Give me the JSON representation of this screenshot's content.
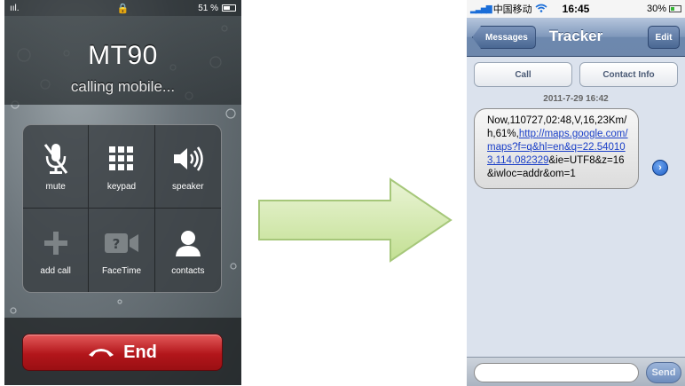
{
  "call_screen": {
    "status_bar": {
      "carrier_signal": "ııl.",
      "battery_text": "51 %"
    },
    "caller_name": "MT90",
    "call_status": "calling mobile...",
    "keys": [
      {
        "label": "mute",
        "icon": "muted-mic-icon"
      },
      {
        "label": "keypad",
        "icon": "keypad-grid-icon"
      },
      {
        "label": "speaker",
        "icon": "speaker-icon"
      },
      {
        "label": "add call",
        "icon": "plus-icon"
      },
      {
        "label": "FaceTime",
        "icon": "facetime-icon"
      },
      {
        "label": "contacts",
        "icon": "contacts-icon"
      }
    ],
    "end_label": "End"
  },
  "arrow": {
    "color": "#cfe6a8",
    "icon": "right-arrow-icon"
  },
  "sms_screen": {
    "status_bar": {
      "carrier": "中国移动",
      "time": "16:45",
      "battery": "30%"
    },
    "nav": {
      "back_label": "Messages",
      "title": "Tracker",
      "edit_label": "Edit"
    },
    "actions": {
      "call": "Call",
      "contact_info": "Contact Info"
    },
    "timestamp": "2011-7-29 16:42",
    "message": {
      "prefix": "Now,110727,02:48,V,16,23Km/h,61%,",
      "link": "http://maps.google.com/maps?f=q&hl=en&q=22.540103,114.082329",
      "suffix": "&ie=UTF8&z=16&iwloc=addr&om=1"
    },
    "send_label": "Send"
  }
}
